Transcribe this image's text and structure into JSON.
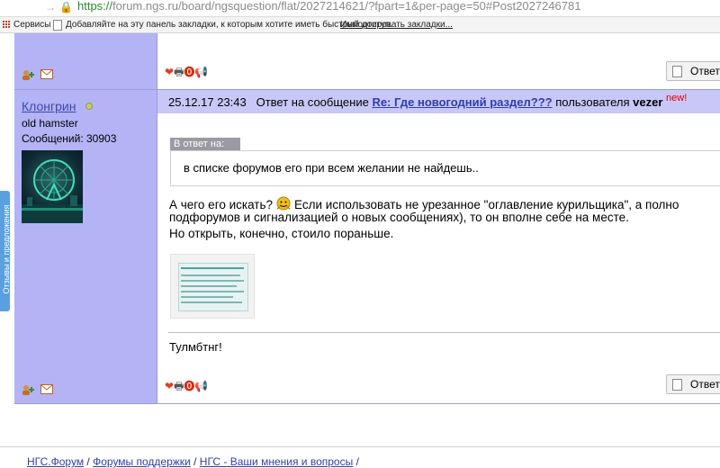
{
  "browser": {
    "url_scheme": "https://",
    "url_rest": "forum.ngs.ru/board/ngsquestion/flat/2027214621/?fpart=1&per-page=50#Post2027246781"
  },
  "bookmarks": {
    "apps_label": "Сервисы",
    "hint": "Добавляйте на эту панель закладки, к которым хотите иметь быстрый доступ.",
    "import_link": "Импортировать закладки..."
  },
  "side_tab_label": "Отзывы и предложения",
  "post": {
    "username": "Клонгрин",
    "rank": "old hamster",
    "post_count": "Сообщений: 30903",
    "header": {
      "datetime": "25.12.17 23:43",
      "reply_text": "Ответ на сообщение",
      "thread_link": "Re: Где новогодний раздел???",
      "by_user_text": "пользователя",
      "author": "vezer",
      "new_badge": "new!"
    },
    "quote": {
      "label": "В ответ на:",
      "text": "в списке форумов его при всем желании не найдешь.."
    },
    "body": {
      "line1_a": "А чего его искать?",
      "line1_b": "Если использовать не урезанное \"оглавление курильщика\", а полно",
      "line2": "подфорумов и сигнализацией о новых сообщениях), то он вполне себе на месте.",
      "line3": "Но открыть, конечно, стоило пораньше."
    },
    "signature": "Тулмбтнг!"
  },
  "actions": {
    "reply_button": "Ответ"
  },
  "breadcrumb": {
    "items": [
      "НГС.Форум",
      "Форумы поддержки",
      "НГС - Ваши мнения и вопросы"
    ],
    "separator": "/"
  },
  "colors": {
    "user_column": "#b3b3f5",
    "post_header": "#c8c8f8",
    "link": "#2f3fa8",
    "new_badge": "#e00000"
  }
}
